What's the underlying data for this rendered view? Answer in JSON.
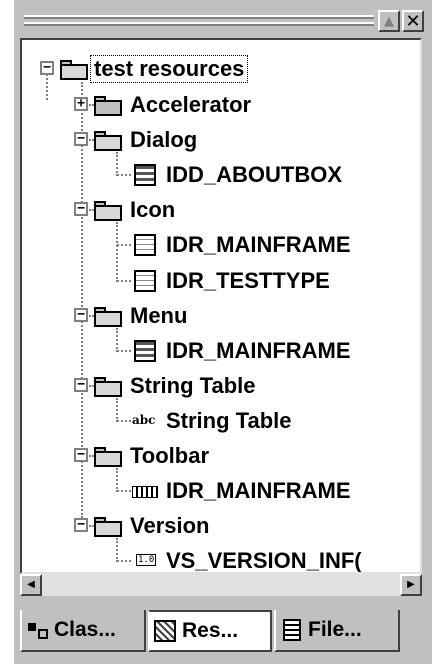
{
  "window": {
    "buttons": {
      "maximize_glyph": "▲",
      "close_glyph": "✕"
    }
  },
  "tree": {
    "root": {
      "label": "test resources",
      "expander": "−"
    },
    "folders": [
      {
        "label": "Accelerator",
        "expander": "+",
        "children": []
      },
      {
        "label": "Dialog",
        "expander": "−",
        "children": [
          {
            "label": "IDD_ABOUTBOX",
            "icon": "dialog-icon"
          }
        ]
      },
      {
        "label": "Icon",
        "expander": "−",
        "children": [
          {
            "label": "IDR_MAINFRAME",
            "icon": "icon-resource-icon"
          },
          {
            "label": "IDR_TESTTYPE",
            "icon": "icon-resource-icon"
          }
        ]
      },
      {
        "label": "Menu",
        "expander": "−",
        "children": [
          {
            "label": "IDR_MAINFRAME",
            "icon": "menu-icon"
          }
        ]
      },
      {
        "label": "String Table",
        "expander": "−",
        "children": [
          {
            "label": "String Table",
            "icon": "abc-icon",
            "icon_text": "abc"
          }
        ]
      },
      {
        "label": "Toolbar",
        "expander": "−",
        "children": [
          {
            "label": "IDR_MAINFRAME",
            "icon": "toolbar-icon"
          }
        ]
      },
      {
        "label": "Version",
        "expander": "−",
        "children": [
          {
            "label": "VS_VERSION_INF(",
            "icon": "version-icon",
            "icon_text": "1.0"
          }
        ]
      }
    ]
  },
  "scrollbar": {
    "left_glyph": "◀",
    "right_glyph": "▶"
  },
  "tabs": [
    {
      "label": "Clas...",
      "icon": "class-view-icon",
      "active": false
    },
    {
      "label": "Res...",
      "icon": "resource-view-icon",
      "active": true
    },
    {
      "label": "File...",
      "icon": "file-view-icon",
      "active": false
    }
  ]
}
